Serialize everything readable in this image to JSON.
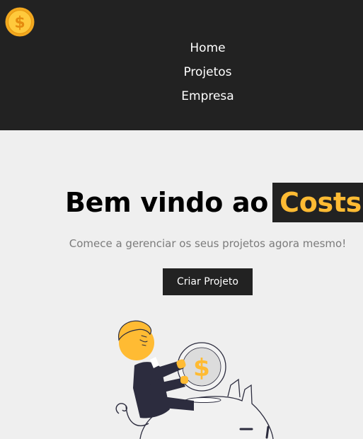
{
  "navbar": {
    "logo_icon": "coin-dollar-icon",
    "links": [
      {
        "label": "Home"
      },
      {
        "label": "Projetos"
      },
      {
        "label": "Empresa"
      }
    ]
  },
  "hero": {
    "title_prefix": "Bem vindo ao",
    "brand": "Costs",
    "subtitle": "Comece a gerenciar os seus projetos agora mesmo!",
    "cta_label": "Criar Projeto",
    "illustration": "savings-person-coin-piggy-bank-illustration"
  },
  "colors": {
    "navbar_bg": "#222222",
    "page_bg": "#efefef",
    "accent": "#ffbb33",
    "subtitle_text": "#7b7b7b"
  }
}
